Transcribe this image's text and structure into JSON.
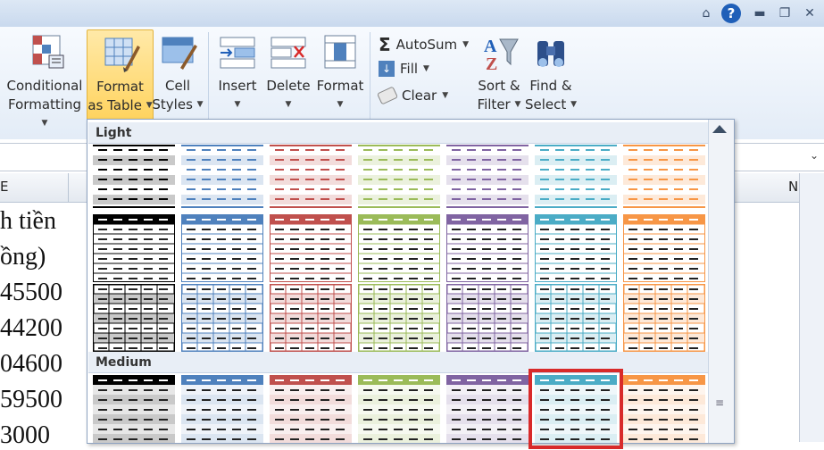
{
  "ribbon": {
    "conditional_formatting": {
      "line1": "Conditional",
      "line2": "Formatting"
    },
    "format_as_table": {
      "line1": "Format",
      "line2": "as Table"
    },
    "cell_styles": {
      "line1": "Cell",
      "line2": "Styles"
    },
    "insert": "Insert",
    "delete": "Delete",
    "format": "Format",
    "autosum": "AutoSum",
    "fill": "Fill",
    "clear": "Clear",
    "sort_filter": {
      "line1": "Sort &",
      "line2": "Filter"
    },
    "find_select": {
      "line1": "Find &",
      "line2": "Select"
    }
  },
  "titlebar": {
    "help": "?"
  },
  "sheet": {
    "column_e": "E",
    "column_n": "N",
    "cells": [
      "h tiền",
      "ồng)",
      "45500",
      "44200",
      "04600",
      "59500",
      "3000"
    ]
  },
  "gallery": {
    "section_light": "Light",
    "section_medium": "Medium",
    "colors": [
      "#000000",
      "#4f81bd",
      "#c0504d",
      "#9bbb59",
      "#8064a2",
      "#4bacc6",
      "#f79646"
    ],
    "light_colors": [
      "#c9c9c9",
      "#dbe5f1",
      "#f2dcdb",
      "#ebf1dd",
      "#e5e0ec",
      "#dbeef3",
      "#fde9d9"
    ],
    "selected_style": "Medium row 1, style 6"
  }
}
